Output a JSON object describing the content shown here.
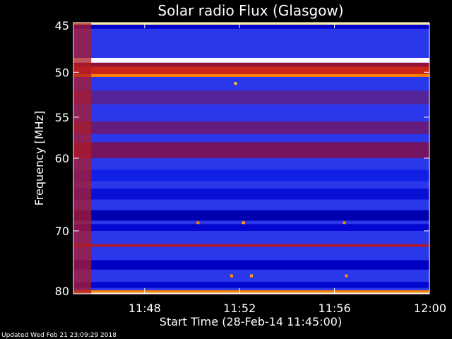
{
  "chart_data": {
    "type": "heatmap",
    "title": "Solar radio Flux (Glasgow)",
    "xlabel": "Start Time (28-Feb-14 11:45:00)",
    "ylabel": "Frequency [MHz]",
    "x_unit": "minutes",
    "xlim": [
      "11:45",
      "12:00"
    ],
    "ylim": [
      45,
      80
    ],
    "y_scale": "log",
    "y_reversed": true,
    "x_ticks": [
      "11:48",
      "11:52",
      "11:56",
      "12:00"
    ],
    "y_ticks": [
      "45",
      "50",
      "55",
      "60",
      "70",
      "80"
    ],
    "colormap": [
      "#00003a",
      "#0000c8",
      "#1f3cff",
      "#8a0b3a",
      "#d62a12",
      "#ff8a00",
      "#ffe36a",
      "#ffffff"
    ],
    "background_intensity": 0.3,
    "horizontal_bands": [
      {
        "freq_start": 45.0,
        "freq_end": 45.2,
        "intensity": 0.9
      },
      {
        "freq_start": 45.2,
        "freq_end": 45.6,
        "intensity": 0.15
      },
      {
        "freq_start": 48.5,
        "freq_end": 49.0,
        "intensity": 1.0
      },
      {
        "freq_start": 49.0,
        "freq_end": 49.4,
        "intensity": 0.45
      },
      {
        "freq_start": 49.4,
        "freq_end": 50.2,
        "intensity": 0.55
      },
      {
        "freq_start": 50.2,
        "freq_end": 50.5,
        "intensity": 0.7
      },
      {
        "freq_start": 52.0,
        "freq_end": 53.5,
        "intensity": 0.36
      },
      {
        "freq_start": 55.5,
        "freq_end": 57.0,
        "intensity": 0.38
      },
      {
        "freq_start": 58.0,
        "freq_end": 60.0,
        "intensity": 0.4
      },
      {
        "freq_start": 61.5,
        "freq_end": 63.0,
        "intensity": 0.22
      },
      {
        "freq_start": 64.0,
        "freq_end": 65.5,
        "intensity": 0.18
      },
      {
        "freq_start": 67.0,
        "freq_end": 68.5,
        "intensity": 0.12
      },
      {
        "freq_start": 69.0,
        "freq_end": 70.0,
        "intensity": 0.16
      },
      {
        "freq_start": 72.0,
        "freq_end": 72.4,
        "intensity": 0.5
      },
      {
        "freq_start": 74.5,
        "freq_end": 76.0,
        "intensity": 0.14
      },
      {
        "freq_start": 78.0,
        "freq_end": 79.0,
        "intensity": 0.16
      },
      {
        "freq_start": 79.4,
        "freq_end": 79.8,
        "intensity": 0.7
      },
      {
        "freq_start": 79.8,
        "freq_end": 80.0,
        "intensity": 0.95
      }
    ],
    "early_burst": {
      "time_start": "11:45:00",
      "time_end": "11:45:45",
      "intensity": 0.5
    },
    "spikes": [
      {
        "time": "11:51:50",
        "freq": 51.2,
        "intensity": 0.8
      },
      {
        "time": "11:50:15",
        "freq": 68.8,
        "intensity": 0.7
      },
      {
        "time": "11:52:10",
        "freq": 68.8,
        "intensity": 0.75
      },
      {
        "time": "11:56:25",
        "freq": 68.8,
        "intensity": 0.7
      },
      {
        "time": "11:51:40",
        "freq": 77.0,
        "intensity": 0.72
      },
      {
        "time": "11:52:30",
        "freq": 77.0,
        "intensity": 0.75
      },
      {
        "time": "11:56:30",
        "freq": 77.0,
        "intensity": 0.72
      }
    ]
  },
  "footer": {
    "updated": "Updated Wed Feb 21 23:09:29 2018"
  }
}
